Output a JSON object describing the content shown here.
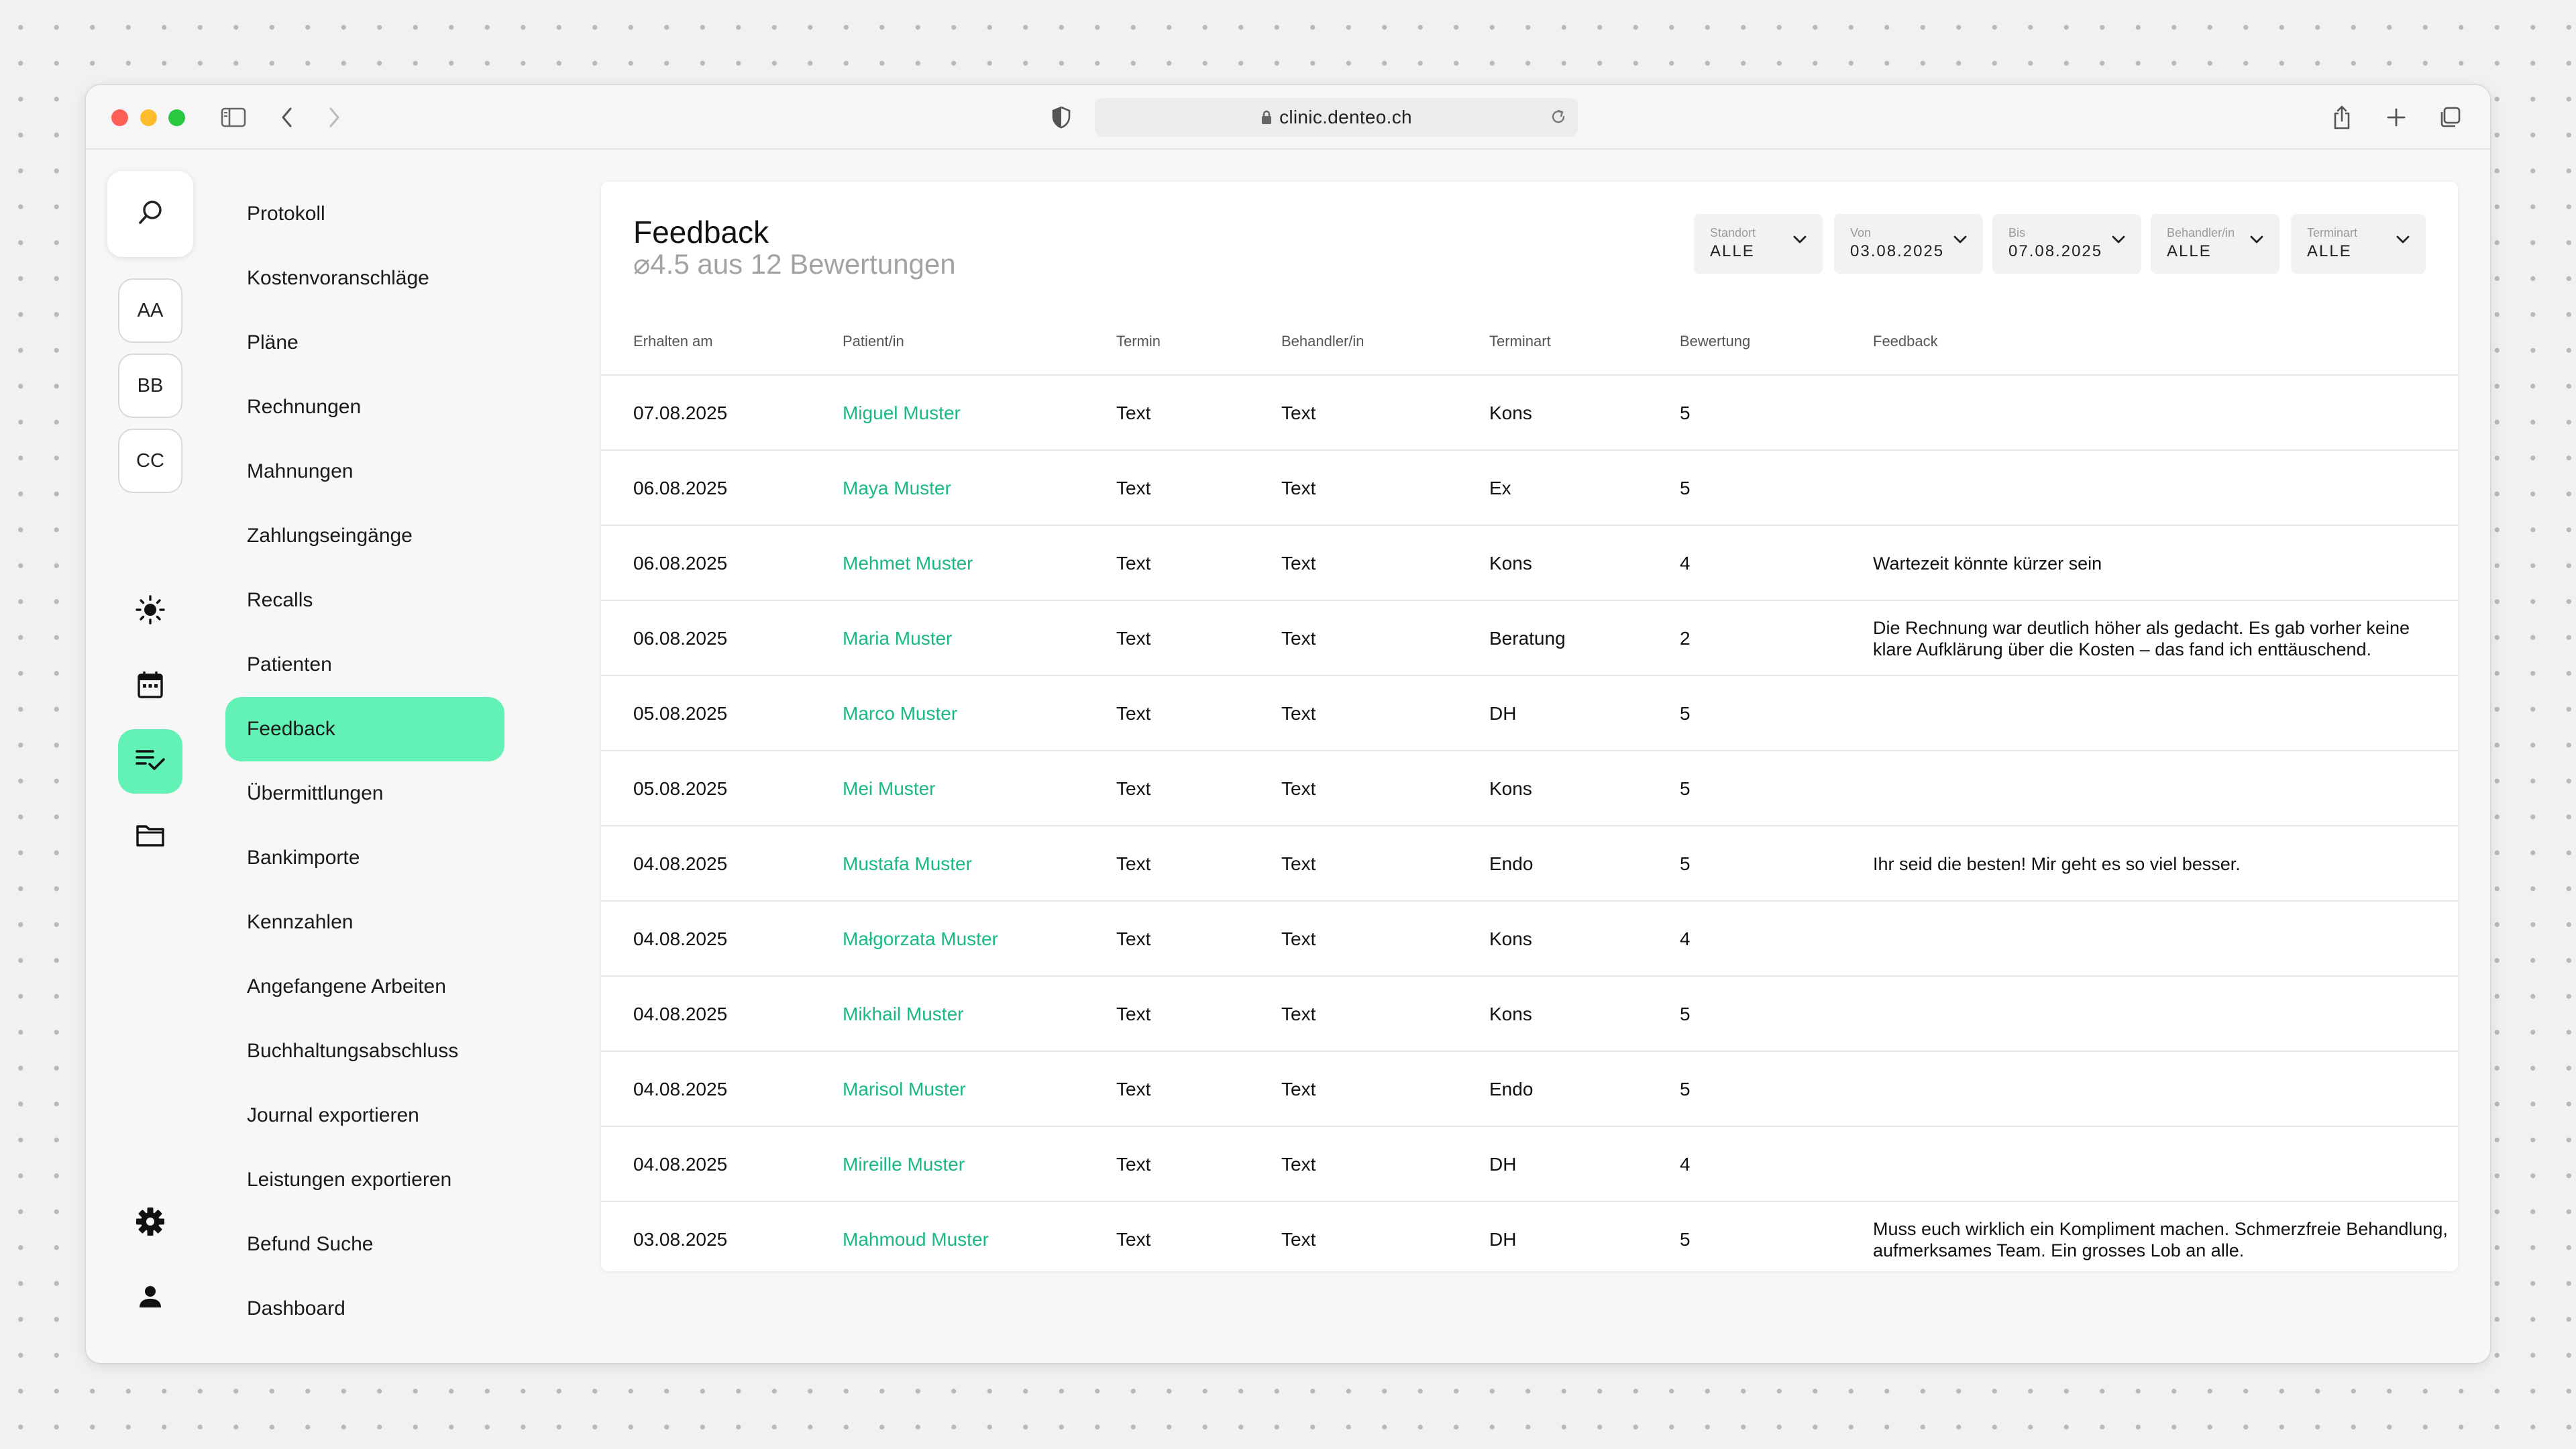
{
  "browser": {
    "url": "clinic.denteo.ch"
  },
  "rail": {
    "avatars": [
      "AA",
      "BB",
      "CC"
    ]
  },
  "nav": {
    "items": [
      "Protokoll",
      "Kostenvoranschläge",
      "Pläne",
      "Rechnungen",
      "Mahnungen",
      "Zahlungseingänge",
      "Recalls",
      "Patienten",
      "Feedback",
      "Übermittlungen",
      "Bankimporte",
      "Kennzahlen",
      "Angefangene Arbeiten",
      "Buchhaltungsabschluss",
      "Journal exportieren",
      "Leistungen exportieren",
      "Befund Suche",
      "Dashboard"
    ],
    "active": "Feedback"
  },
  "main": {
    "title": "Feedback",
    "subtitle": "⌀4.5 aus 12 Bewertungen",
    "filters": [
      {
        "label": "Standort",
        "value": "ALLE"
      },
      {
        "label": "Von",
        "value": "03.08.2025"
      },
      {
        "label": "Bis",
        "value": "07.08.2025"
      },
      {
        "label": "Behandler/in",
        "value": "ALLE"
      },
      {
        "label": "Terminart",
        "value": "ALLE"
      }
    ],
    "columns": [
      "Erhalten am",
      "Patient/in",
      "Termin",
      "Behandler/in",
      "Terminart",
      "Bewertung",
      "Feedback"
    ],
    "rows": [
      [
        "07.08.2025",
        "Miguel Muster",
        "Text",
        "Text",
        "Kons",
        "5",
        ""
      ],
      [
        "06.08.2025",
        "Maya Muster",
        "Text",
        "Text",
        "Ex",
        "5",
        ""
      ],
      [
        "06.08.2025",
        "Mehmet Muster",
        "Text",
        "Text",
        "Kons",
        "4",
        "Wartezeit könnte kürzer sein"
      ],
      [
        "06.08.2025",
        "Maria Muster",
        "Text",
        "Text",
        "Beratung",
        "2",
        "Die Rechnung war deutlich höher als gedacht. Es gab vorher keine klare Aufklärung über die Kosten – das fand ich enttäuschend."
      ],
      [
        "05.08.2025",
        "Marco Muster",
        "Text",
        "Text",
        "DH",
        "5",
        ""
      ],
      [
        "05.08.2025",
        "Mei Muster",
        "Text",
        "Text",
        "Kons",
        "5",
        ""
      ],
      [
        "04.08.2025",
        "Mustafa Muster",
        "Text",
        "Text",
        "Endo",
        "5",
        "Ihr seid die besten! Mir geht es so viel besser."
      ],
      [
        "04.08.2025",
        "Małgorzata Muster",
        "Text",
        "Text",
        "Kons",
        "4",
        ""
      ],
      [
        "04.08.2025",
        "Mikhail Muster",
        "Text",
        "Text",
        "Kons",
        "5",
        ""
      ],
      [
        "04.08.2025",
        "Marisol Muster",
        "Text",
        "Text",
        "Endo",
        "5",
        ""
      ],
      [
        "04.08.2025",
        "Mireille Muster",
        "Text",
        "Text",
        "DH",
        "4",
        ""
      ],
      [
        "03.08.2025",
        "Mahmoud Muster",
        "Text",
        "Text",
        "DH",
        "5",
        "Muss euch wirklich ein Kompliment machen. Schmerzfreie Behandlung, aufmerksames Team. Ein grosses Lob an alle."
      ]
    ]
  },
  "colors": {
    "accent": "#63f2b6",
    "link": "#1ab886"
  },
  "icons": {
    "toolbar": [
      "sidebar-toggle-icon",
      "back-chevron-icon",
      "forward-chevron-icon",
      "privacy-shield-icon",
      "lock-icon",
      "reload-icon",
      "share-icon",
      "new-tab-plus-icon",
      "tab-overview-icon"
    ],
    "rail": [
      "search-icon",
      "sun-icon",
      "calendar-icon",
      "checklist-icon",
      "folder-icon",
      "gear-icon",
      "person-icon"
    ]
  }
}
